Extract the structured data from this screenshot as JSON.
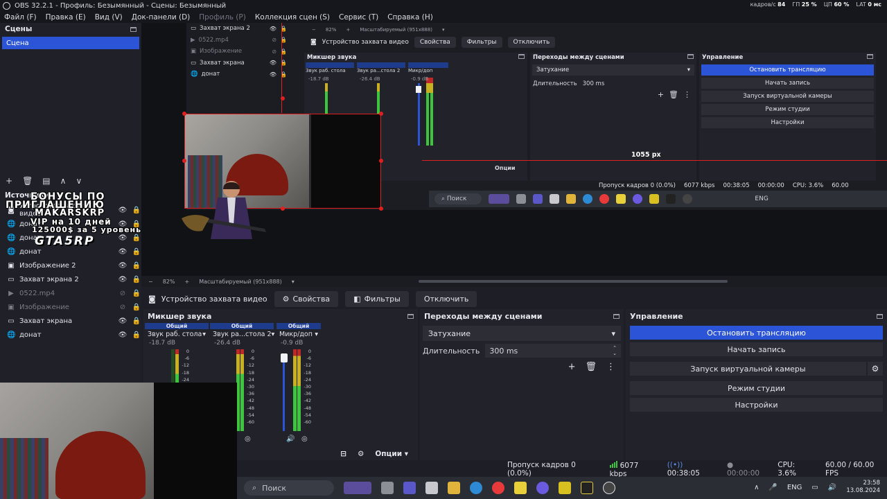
{
  "window": {
    "title": "OBS 32.2.1 - Профиль: Безымянный - Сцены: Безымянный",
    "stats": [
      {
        "label": "кадров/с",
        "value": "84"
      },
      {
        "label": "ГП",
        "value": "25 %"
      },
      {
        "label": "ЦП",
        "value": "60 %"
      },
      {
        "label": "LAT",
        "value": "0 мс"
      }
    ]
  },
  "menu": [
    "Файл (F)",
    "Правка (E)",
    "Вид (V)",
    "Док-панели (D)",
    "Профиль (P)",
    "Коллекция сцен (S)",
    "Сервис (T)",
    "Справка (H)"
  ],
  "scenes": {
    "title": "Сцены",
    "items": [
      "Сцена"
    ]
  },
  "sources": {
    "title": "Источники",
    "items": [
      {
        "name": "Устройство захвата видео",
        "icon": "camera-icon",
        "visible": true
      },
      {
        "name": "донат",
        "icon": "globe-icon",
        "visible": true
      },
      {
        "name": "донат",
        "icon": "globe-icon",
        "visible": true
      },
      {
        "name": "донат",
        "icon": "globe-icon",
        "visible": true
      },
      {
        "name": "Изображение 2",
        "icon": "image-icon",
        "visible": true
      },
      {
        "name": "Захват экрана 2",
        "icon": "monitor-icon",
        "visible": true
      },
      {
        "name": "0522.mp4",
        "icon": "play-icon",
        "visible": false
      },
      {
        "name": "Изображение",
        "icon": "image-icon",
        "visible": false
      },
      {
        "name": "Захват экрана",
        "icon": "monitor-icon",
        "visible": true
      },
      {
        "name": "донат",
        "icon": "globe-icon",
        "visible": true
      }
    ]
  },
  "overlay": {
    "lines": [
      "БОНУСЫ ПО",
      "ПРИГЛАШЕНИЮ",
      "MAKARSKRP",
      "VIP на 10 дней",
      "125000$ за 5 уровень"
    ],
    "logo": "GTA5RP"
  },
  "nested": {
    "sources": [
      {
        "name": "Захват экрана 2",
        "visible": true
      },
      {
        "name": "0522.mp4",
        "visible": false
      },
      {
        "name": "Изображение",
        "visible": false
      },
      {
        "name": "Захват экрана",
        "visible": true
      },
      {
        "name": "донат",
        "visible": true
      }
    ],
    "zoom": "82%",
    "scale_label": "Масштабируемый (951x888)",
    "ctx_label": "Устройство захвата видео",
    "props": "Свойства",
    "filters": "Фильтры",
    "disable": "Отключить",
    "mixer_title": "Микшер звука",
    "trans_title": "Переходы между сценами",
    "ctrl_title": "Управление",
    "transition": "Затухание",
    "duration_label": "Длительность",
    "duration": "300 ms",
    "ctrl_buttons": [
      "Остановить трансляцию",
      "Начать запись",
      "Запуск виртуальной камеры",
      "Режим студии",
      "Настройки"
    ],
    "channels": [
      "Звук раб. стола",
      "Звук ра...стола 2",
      "Микр/доп"
    ],
    "channel_tag": "Общий",
    "channel_db": [
      "-18.7 dB",
      "-26.4 dB",
      "-0.9 dB"
    ],
    "options": "Опции",
    "px_label": "1055 px",
    "status": {
      "dropped": "Пропуск кадров 0 (0.0%)",
      "kbps": "6077 kbps",
      "time": "00:38:05",
      "rec": "00:00:00",
      "cpu": "CPU: 3.6%",
      "fps": "60.00"
    },
    "search": "Поиск",
    "lang": "ENG"
  },
  "preview_toolbar": {
    "zoom": "82%",
    "scale_label": "Масштабируемый (951x888)"
  },
  "context_bar": {
    "label": "Устройство захвата видео",
    "properties": "Свойства",
    "filters": "Фильтры",
    "disable": "Отключить"
  },
  "mixer": {
    "title": "Микшер звука",
    "tag": "Общий",
    "channels": [
      {
        "name": "Звук раб. стола",
        "db": "-18.7 dB"
      },
      {
        "name": "Звук ра...стола 2",
        "db": "-26.4 dB"
      },
      {
        "name": "Микр/доп",
        "db": "-0.9 dB"
      }
    ],
    "scale": [
      "0",
      "-6",
      "-12",
      "-18",
      "-24",
      "-30",
      "-36",
      "-42",
      "-48",
      "-54",
      "-60"
    ],
    "options": "Опции"
  },
  "transitions": {
    "title": "Переходы между сценами",
    "selected": "Затухание",
    "duration_label": "Длительность",
    "duration": "300 ms"
  },
  "controls": {
    "title": "Управление",
    "stop_stream": "Остановить трансляцию",
    "start_record": "Начать запись",
    "virtual_cam": "Запуск виртуальной камеры",
    "studio_mode": "Режим студии",
    "settings": "Настройки"
  },
  "status": {
    "dropped": "Пропуск кадров 0 (0.0%)",
    "kbps": "6077 kbps",
    "stream_time": "00:38:05",
    "rec_time": "00:00:00",
    "cpu": "CPU: 3.6%",
    "fps": "60.00 / 60.00 FPS"
  },
  "taskbar": {
    "search": "Поиск",
    "lang": "ENG",
    "time": "23:58",
    "date": "13.08.2024"
  },
  "colors": {
    "accent": "#2b55d6",
    "selection": "#e02020",
    "meter_green": "#3ec43e",
    "meter_yellow": "#c8b020",
    "meter_red": "#c02828"
  }
}
